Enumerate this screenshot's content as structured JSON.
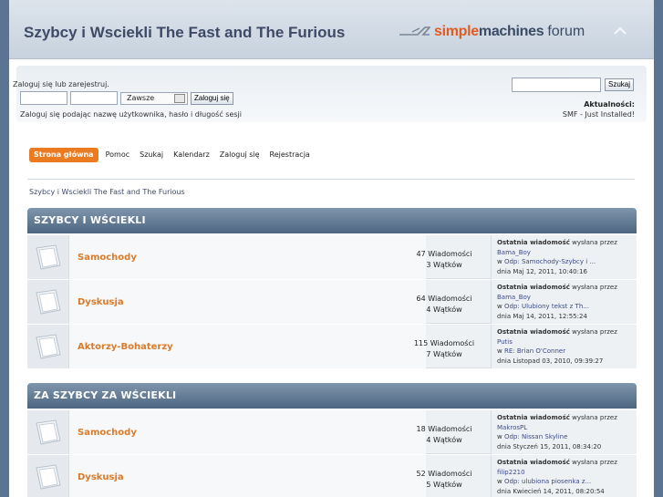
{
  "header": {
    "forum_title": "Szybcy i Wsciekli The Fast and The Furious",
    "logo_simple": "simple",
    "logo_machines": "machines",
    "logo_forum": "forum"
  },
  "userbar": {
    "login_hint": "Zaloguj się lub zarejestruj.",
    "duration_select": "Zawsze",
    "login_button": "Zaloguj się",
    "login_note": "Zaloguj się podając nazwę użytkownika, hasło i długość sesji",
    "search_button": "Szukaj",
    "news_title": "Aktualności:",
    "news_text": "SMF - Just Installed!"
  },
  "menu": {
    "items": [
      "Strona główna",
      "Pomoc",
      "Szukaj",
      "Kalendarz",
      "Zaloguj się",
      "Rejestracja"
    ]
  },
  "breadcrumb": "Szybcy i Wsciekli The Fast and The Furious",
  "categories": [
    {
      "title": "SZYBCY I WŚCIEKLI",
      "boards": [
        {
          "name": "Samochody",
          "posts": "47 Wiadomości",
          "topics": "3 Wątków",
          "last_label": "Ostatnia wiadomość",
          "last_by": "wysłana przez",
          "last_user": "Bama_Boy",
          "last_in": "w",
          "last_topic": "Odp: Samochody-Szybcy i ...",
          "last_date": "dnia Maj 12, 2011, 10:40:16"
        },
        {
          "name": "Dyskusja",
          "posts": "64 Wiadomości",
          "topics": "4 Wątków",
          "last_label": "Ostatnia wiadomość",
          "last_by": "wysłana przez",
          "last_user": "Bama_Boy",
          "last_in": "w",
          "last_topic": "Odp: Ulubiony tekst z Th...",
          "last_date": "dnia Maj 14, 2011, 12:55:24"
        },
        {
          "name": "Aktorzy-Bohaterzy",
          "posts": "115 Wiadomości",
          "topics": "7 Wątków",
          "last_label": "Ostatnia wiadomość",
          "last_by": "wysłana przez",
          "last_user": "Putis",
          "last_in": "w",
          "last_topic": "RE: Brian O'Conner",
          "last_date": "dnia Listopad 03, 2010, 09:39:27"
        }
      ]
    },
    {
      "title": "ZA SZYBCY ZA WŚCIEKLI",
      "boards": [
        {
          "name": "Samochody",
          "posts": "18 Wiadomości",
          "topics": "4 Wątków",
          "last_label": "Ostatnia wiadomość",
          "last_by": "wysłana przez",
          "last_user": "MakrosPL",
          "last_in": "w",
          "last_topic": "Odp: Nissan Skyline",
          "last_date": "dnia Styczeń 15, 2011, 08:34:20"
        },
        {
          "name": "Dyskusja",
          "posts": "52 Wiadomości",
          "topics": "5 Wątków",
          "last_label": "Ostatnia wiadomość",
          "last_by": "wysłana przez",
          "last_user": "filip2210",
          "last_in": "w",
          "last_topic": "Odp: ulubiona piosenka z...",
          "last_date": "dnia Kwiecień 14, 2011, 08:20:54"
        }
      ]
    }
  ]
}
